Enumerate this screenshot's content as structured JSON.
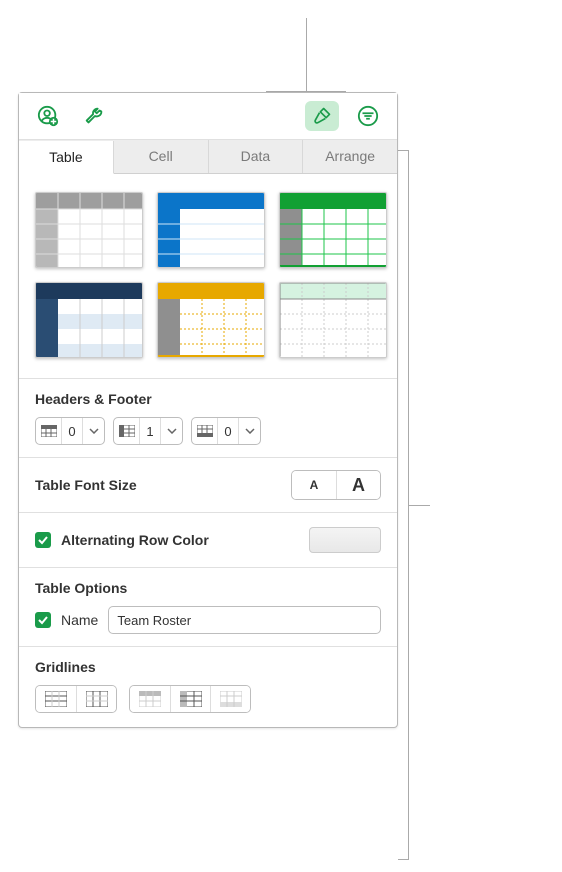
{
  "tabs": {
    "items": [
      "Table",
      "Cell",
      "Data",
      "Arrange"
    ],
    "active": 0
  },
  "headers_footer": {
    "title": "Headers & Footer",
    "header_rows": 0,
    "header_cols": 1,
    "footer_rows": 0
  },
  "font_size": {
    "label": "Table Font Size",
    "small_glyph": "A",
    "large_glyph": "A"
  },
  "alt_row": {
    "label": "Alternating Row Color",
    "checked": true,
    "color": "#eeeeee"
  },
  "table_options": {
    "title": "Table Options",
    "name_label": "Name",
    "name_checked": true,
    "name_value": "Team Roster"
  },
  "gridlines": {
    "title": "Gridlines"
  },
  "styles": {
    "accent": "#1a9b4a"
  }
}
